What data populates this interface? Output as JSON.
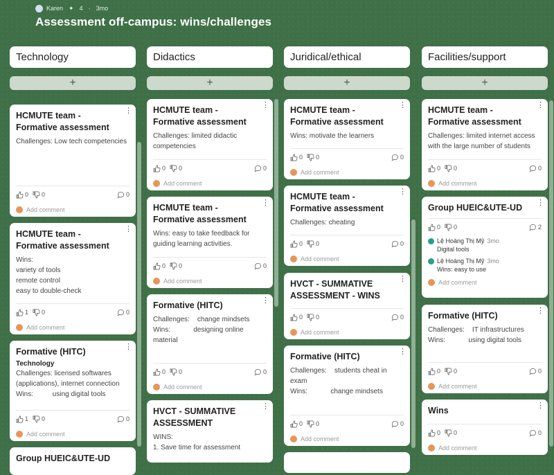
{
  "header": {
    "author": "Karen",
    "likes": "4",
    "time": "3mo",
    "title": "Assessment off-campus: wins/challenges"
  },
  "add_symbol": "+",
  "columns": [
    {
      "name": "Technology",
      "cards": [
        {
          "title": "HCMUTE team - Formative assessment",
          "body": "Challenges: Low tech competencies",
          "likes": "0",
          "dislikes": "0",
          "comments": "0",
          "add_comment": "Add comment"
        },
        {
          "title": "HCMUTE team - Formative assessment",
          "body": "Wins:\nvariety of tools\nremote control\neasy to double-check",
          "likes": "1",
          "dislikes": "0",
          "comments": "0",
          "add_comment": "Add comment"
        },
        {
          "title": "Formative (HITC)",
          "subtitle": "Technology",
          "body": "Challenges: licensed softwares (applications), internet connection\nWins:          using digital tools",
          "likes": "1",
          "dislikes": "0",
          "comments": "0",
          "add_comment": "Add comment"
        },
        {
          "title": "Group HUEIC&UTE-UD"
        }
      ]
    },
    {
      "name": "Didactics",
      "cards": [
        {
          "title": "HCMUTE team - Formative assessment",
          "body": "Challenges: limited didactic competencies",
          "likes": "0",
          "dislikes": "0",
          "comments": "0",
          "add_comment": "Add comment"
        },
        {
          "title": "HCMUTE team - Formative assessment",
          "body": "Wins: easy to take feedback for guiding learning activities.",
          "likes": "0",
          "dislikes": "0",
          "comments": "0",
          "add_comment": "Add comment"
        },
        {
          "title": "Formative (HITC)",
          "body": "Challenges:    change mindsets\nWins:            designing online material",
          "likes": "0",
          "dislikes": "0",
          "comments": "0",
          "add_comment": "Add comment"
        },
        {
          "title": "HVCT - SUMMATIVE ASSESSMENT",
          "body": "WINS:\n1. Save time for assessment"
        }
      ]
    },
    {
      "name": "Juridical/ethical",
      "cards": [
        {
          "title": "HCMUTE team - Formative assessment",
          "body": "Wins: motivate the learners",
          "likes": "0",
          "dislikes": "0",
          "comments": "0",
          "add_comment": "Add comment"
        },
        {
          "title": "HCMUTE team - Formative assessment",
          "body": "Challenges: cheating",
          "likes": "0",
          "dislikes": "0",
          "comments": "0",
          "add_comment": "Add comment"
        },
        {
          "title": "HVCT - SUMMATIVE ASSESSMENT - WINS",
          "likes": "0",
          "dislikes": "0",
          "comments": "0",
          "add_comment": "Add comment"
        },
        {
          "title": "Formative (HITC)",
          "body": "Challenges:    students cheat in exam\nWins:            change mindsets",
          "likes": "0",
          "dislikes": "0",
          "comments": "0",
          "add_comment": "Add comment"
        }
      ]
    },
    {
      "name": "Facilities/support",
      "cards": [
        {
          "title": "HCMUTE team - Formative assessment",
          "body": "Challenges: limited internet access with the large number of students",
          "likes": "0",
          "dislikes": "0",
          "comments": "0",
          "add_comment": "Add comment"
        },
        {
          "title": "Group HUEIC&UTE-UD",
          "likes": "0",
          "dislikes": "0",
          "comments": "2",
          "add_comment": "Add comment",
          "comment_list": [
            {
              "author": "Lệ Hoàng Thị Mỹ",
              "time": "3mo",
              "text": "Digital tools"
            },
            {
              "author": "Lệ Hoàng Thị Mỹ",
              "time": "3mo",
              "text": "Wins: easy to use"
            }
          ]
        },
        {
          "title": "Formative (HITC)",
          "body": "Challenges:    IT infrastructures\nWins:            using digital tools",
          "likes": "0",
          "dislikes": "0",
          "comments": "0",
          "add_comment": "Add comment"
        },
        {
          "title": "Wins",
          "likes": "0",
          "dislikes": "0",
          "comments": "0",
          "add_comment": "Add comment"
        }
      ]
    }
  ]
}
